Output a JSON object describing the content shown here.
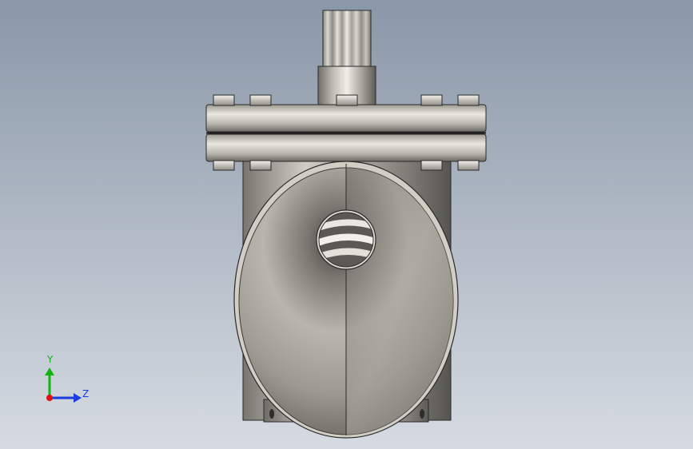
{
  "viewport": {
    "background_top": "#8a97a8",
    "background_bottom": "#d6dbe2"
  },
  "triad": {
    "y_label": "Y",
    "z_label": "Z",
    "x_color": "#e01010",
    "y_color": "#11b311",
    "z_color": "#1a3be0"
  },
  "model": {
    "metal_light": "#e8e7df",
    "metal_mid": "#a9a79d",
    "metal_dark": "#5c5b55",
    "edge_color": "#2a2a2a"
  }
}
